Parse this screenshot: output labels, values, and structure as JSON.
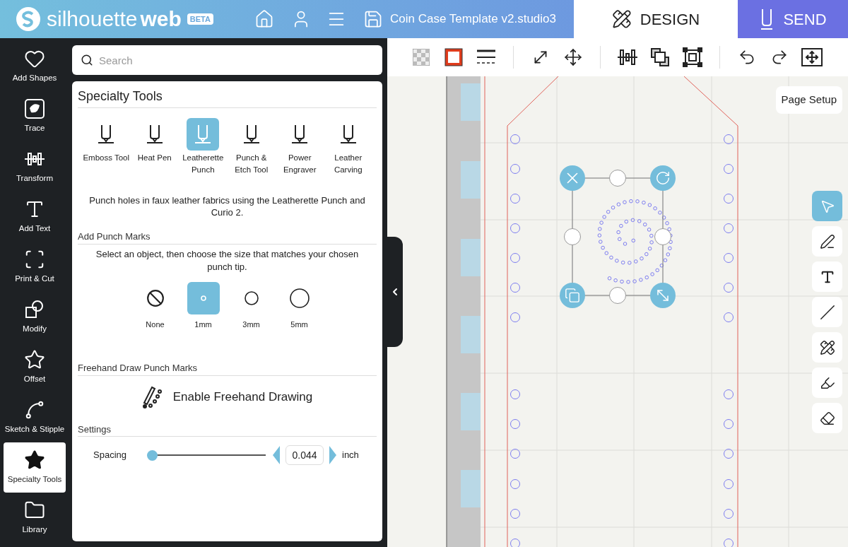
{
  "header": {
    "logo_light": "silhouette",
    "logo_bold": "web",
    "badge": "BETA",
    "filename": "Coin Case Template v2.studio3",
    "tabs": [
      {
        "label": "DESIGN",
        "selected": true
      },
      {
        "label": "SEND",
        "selected": false
      }
    ]
  },
  "rail": [
    {
      "label": "Add Shapes",
      "selected": false
    },
    {
      "label": "Trace",
      "selected": false
    },
    {
      "label": "Transform",
      "selected": false
    },
    {
      "label": "Add Text",
      "selected": false
    },
    {
      "label": "Print & Cut",
      "selected": false
    },
    {
      "label": "Modify",
      "selected": false
    },
    {
      "label": "Offset",
      "selected": false
    },
    {
      "label": "Sketch & Stipple",
      "selected": false
    },
    {
      "label": "Specialty Tools",
      "selected": true
    },
    {
      "label": "Library",
      "selected": false
    }
  ],
  "search": {
    "placeholder": "Search"
  },
  "panel": {
    "title": "Specialty Tools",
    "tools": [
      {
        "label": "Emboss Tool",
        "selected": false
      },
      {
        "label": "Heat Pen",
        "selected": false
      },
      {
        "label": "Leatherette Punch",
        "selected": true
      },
      {
        "label": "Punch & Etch Tool",
        "selected": false
      },
      {
        "label": "Power Engraver",
        "selected": false
      },
      {
        "label": "Leather Carving",
        "selected": false
      }
    ],
    "description": "Punch holes in faux leather fabrics using the Leatherette Punch and Curio 2.",
    "punch_heading": "Add Punch Marks",
    "punch_hint": "Select an object, then choose the size that matches your chosen punch tip.",
    "punch_sizes": [
      {
        "label": "None",
        "selected": false
      },
      {
        "label": "1mm",
        "selected": true
      },
      {
        "label": "3mm",
        "selected": false
      },
      {
        "label": "5mm",
        "selected": false
      }
    ],
    "freehand_heading": "Freehand Draw Punch Marks",
    "freehand_button": "Enable Freehand Drawing",
    "settings_heading": "Settings",
    "spacing": {
      "label": "Spacing",
      "level": 0,
      "value": "0.044",
      "unit": "inch"
    }
  },
  "canvas": {
    "page_setup": "Page Setup",
    "side_tools": [
      {
        "selected": true
      },
      {
        "selected": false
      },
      {
        "selected": false
      },
      {
        "selected": false
      },
      {
        "selected": false
      },
      {
        "selected": false
      },
      {
        "selected": false
      }
    ]
  }
}
